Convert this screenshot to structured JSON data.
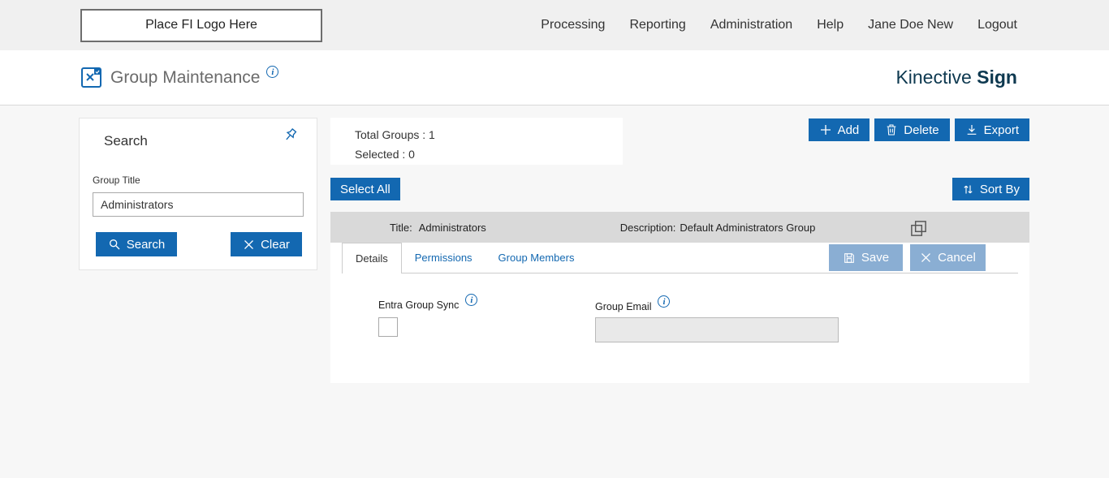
{
  "topbar": {
    "logo_placeholder": "Place FI Logo Here",
    "nav": [
      "Processing",
      "Reporting",
      "Administration",
      "Help",
      "Jane Doe New",
      "Logout"
    ]
  },
  "header": {
    "title": "Group Maintenance",
    "brand_regular": "Kinective",
    "brand_bold": "Sign"
  },
  "search_panel": {
    "title": "Search",
    "group_title_label": "Group Title",
    "group_title_value": "Administrators",
    "search_button": "Search",
    "clear_button": "Clear"
  },
  "summary": {
    "total_groups": "Total Groups : 1",
    "selected": "Selected : 0"
  },
  "toolbar": {
    "add": "Add",
    "delete": "Delete",
    "export": "Export",
    "select_all": "Select All",
    "sort_by": "Sort By"
  },
  "group_row": {
    "title_label": "Title:",
    "title_value": "Administrators",
    "description_label": "Description:",
    "description_value": "Default Administrators Group"
  },
  "tabs": [
    {
      "label": "Details",
      "active": true
    },
    {
      "label": "Permissions",
      "active": false
    },
    {
      "label": "Group Members",
      "active": false
    }
  ],
  "detail_actions": {
    "save": "Save",
    "cancel": "Cancel"
  },
  "details_form": {
    "entra_label": "Entra Group Sync",
    "group_email_label": "Group Email",
    "group_email_value": ""
  },
  "icons": {
    "info": "i",
    "add": "plus",
    "delete": "trash",
    "export": "download-arrow",
    "search": "magnifier",
    "clear": "x-mark",
    "sort": "up-down-arrows",
    "save": "floppy-disk",
    "cancel": "x-mark",
    "pin": "pushpin",
    "copy": "overlapping-squares",
    "page": "document-x"
  },
  "colors": {
    "accent": "#1368b1",
    "brand": "#0e3950",
    "muted_button": "#8aaed3",
    "row_gray": "#d9d9d9",
    "topbar_bg": "#f0f0f0",
    "main_bg": "#f7f7f7"
  }
}
